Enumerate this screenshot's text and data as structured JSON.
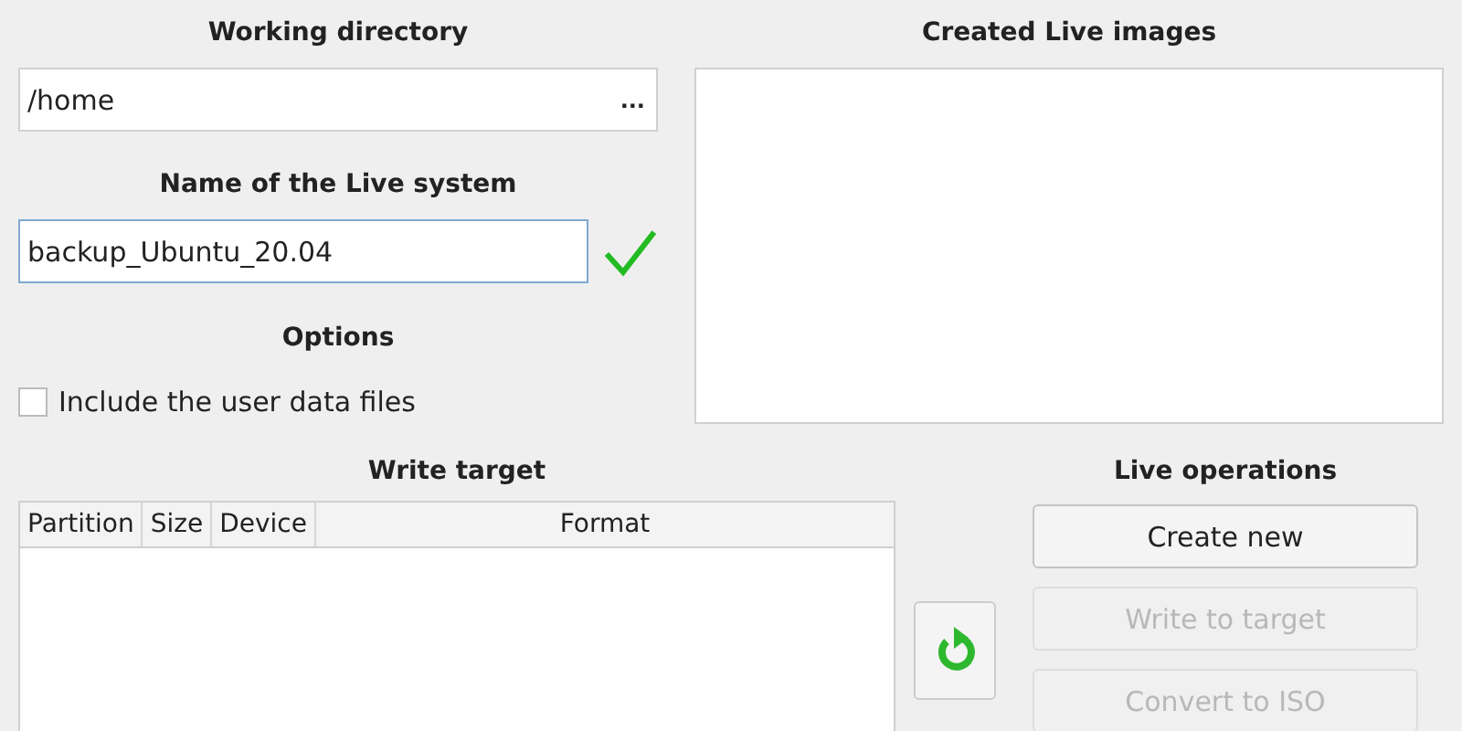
{
  "working_directory": {
    "title": "Working directory",
    "value": "/home",
    "browse_label": "..."
  },
  "live_name": {
    "title": "Name of the Live system",
    "value": "backup_Ubuntu_20.04",
    "valid": true
  },
  "options": {
    "title": "Options",
    "items": [
      {
        "label": "Include the user data files",
        "checked": false
      }
    ]
  },
  "created_images": {
    "title": "Created Live images"
  },
  "write_target": {
    "title": "Write target",
    "columns": [
      "Partition",
      "Size",
      "Device",
      "Format"
    ]
  },
  "live_operations": {
    "title": "Live operations",
    "buttons": [
      {
        "label": "Create new",
        "disabled": false
      },
      {
        "label": "Write to target",
        "disabled": true
      },
      {
        "label": "Convert to ISO",
        "disabled": true
      }
    ]
  }
}
